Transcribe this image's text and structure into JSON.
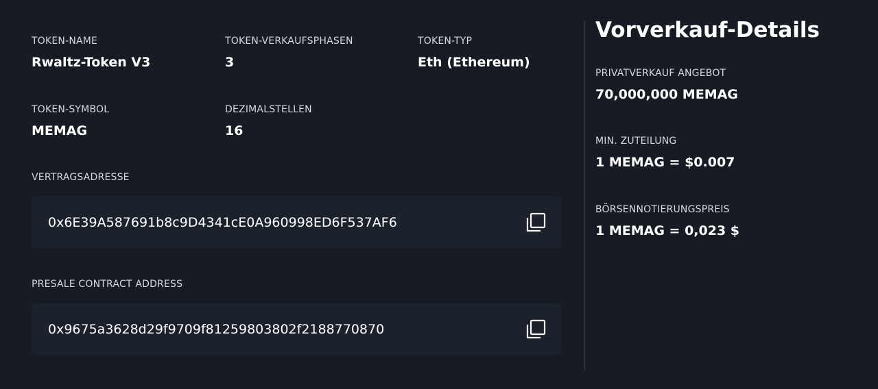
{
  "token_info": {
    "name": {
      "label": "TOKEN-NAME",
      "value": "Rwaltz-Token V3"
    },
    "phases": {
      "label": "TOKEN-VERKAUFSPHASEN",
      "value": "3"
    },
    "type": {
      "label": "TOKEN-TYP",
      "value": "Eth (Ethereum)"
    },
    "symbol": {
      "label": "TOKEN-SYMBOL",
      "value": "MEMAG"
    },
    "decimals": {
      "label": "DEZIMALSTELLEN",
      "value": "16"
    }
  },
  "contract": {
    "label": "VERTRAGSADRESSE",
    "address": "0x6E39A587691b8c9D4341cE0A960998ED6F537AF6",
    "copy_icon": "copy-icon"
  },
  "presale_contract": {
    "label": "PRESALE CONTRACT ADDRESS",
    "address": "0x9675a3628d29f9709f81259803802f2188770870",
    "copy_icon": "copy-icon"
  },
  "presale_details": {
    "title": "Vorverkauf-Details",
    "private_sale": {
      "label": "PRIVATVERKAUF ANGEBOT",
      "value": "70,000,000 MEMAG"
    },
    "min_allocation": {
      "label": "MIN. ZUTEILUNG",
      "value": "1 MEMAG = $0.007"
    },
    "listing_price": {
      "label": "BÖRSENNOTIERUNGSPREIS",
      "value": "1 MEMAG = 0,023 $"
    }
  },
  "colors": {
    "background": "#161b24",
    "address_box": "#1c222c",
    "divider": "#3a414c",
    "label_text": "#d5d9e0",
    "value_text": "#ffffff"
  }
}
